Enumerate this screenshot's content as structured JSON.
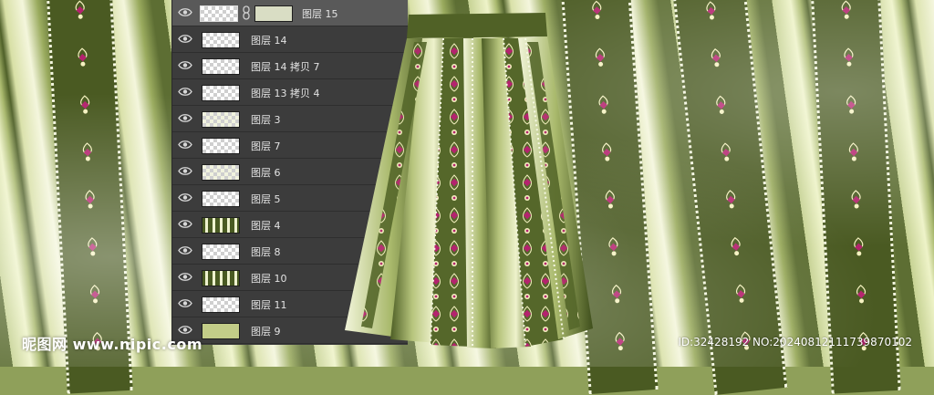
{
  "layers_panel": {
    "layers": [
      {
        "name": "图层 15",
        "thumb": "mask-linked",
        "visible": true,
        "selected": true
      },
      {
        "name": "图层 14",
        "thumb": "transparent",
        "visible": true,
        "selected": false
      },
      {
        "name": "图层 14 拷贝 7",
        "thumb": "transparent",
        "visible": true,
        "selected": false
      },
      {
        "name": "图层 13 拷贝 4",
        "thumb": "transparent",
        "visible": true,
        "selected": false
      },
      {
        "name": "图层 3",
        "thumb": "mottled",
        "visible": true,
        "selected": false
      },
      {
        "name": "图层 7",
        "thumb": "transparent",
        "visible": true,
        "selected": false
      },
      {
        "name": "图层 6",
        "thumb": "mottled",
        "visible": true,
        "selected": false
      },
      {
        "name": "图层 5",
        "thumb": "transparent",
        "visible": true,
        "selected": false
      },
      {
        "name": "图层 4",
        "thumb": "stripes",
        "visible": true,
        "selected": false
      },
      {
        "name": "图层 8",
        "thumb": "transparent",
        "visible": true,
        "selected": false
      },
      {
        "name": "图层 10",
        "thumb": "stripes",
        "visible": true,
        "selected": false
      },
      {
        "name": "图层 11",
        "thumb": "transparent",
        "visible": true,
        "selected": false
      },
      {
        "name": "图层 9",
        "thumb": "solid",
        "visible": true,
        "selected": false
      }
    ]
  },
  "watermark": {
    "site": "昵图网 www.nipic.com",
    "id": "ID:32428192 NO:20240812111739870102"
  },
  "colors": {
    "fabric_dark": "#4a5a22",
    "fabric_light": "#eef3c8",
    "motif_magenta": "#b4236e",
    "motif_cream": "#f5f2c0",
    "panel_bg": "#3c3c3c",
    "panel_selected": "#595959"
  },
  "icons": {
    "visibility": "eye-icon",
    "link": "chain-link-icon"
  }
}
